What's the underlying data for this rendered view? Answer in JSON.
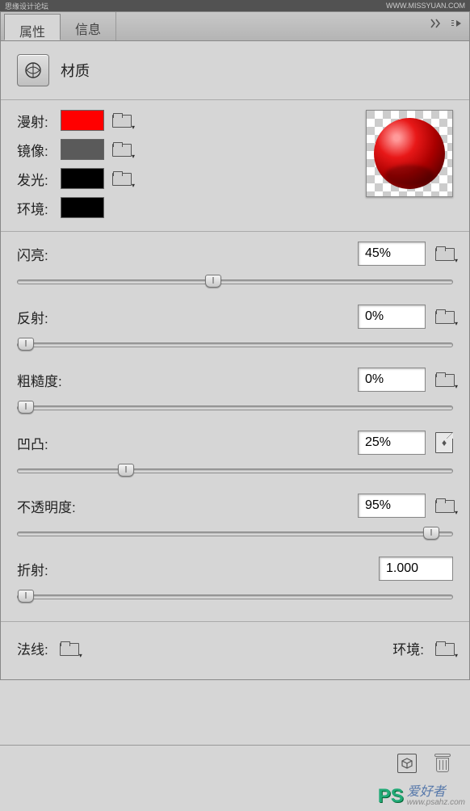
{
  "topbar": {
    "left": "思缘设计论坛",
    "right": "WWW.MISSYUAN.COM"
  },
  "tabs": {
    "properties": "属性",
    "info": "信息"
  },
  "header": {
    "title": "材质"
  },
  "swatches": {
    "diffuse": {
      "label": "漫射:",
      "color": "#ff0000"
    },
    "specular": {
      "label": "镜像:",
      "color": "#5a5a5a"
    },
    "glow": {
      "label": "发光:",
      "color": "#000000"
    },
    "ambient": {
      "label": "环境:",
      "color": "#000000"
    }
  },
  "sliders": {
    "shine": {
      "label": "闪亮:",
      "value": "45%",
      "pos": 45
    },
    "reflection": {
      "label": "反射:",
      "value": "0%",
      "pos": 0
    },
    "roughness": {
      "label": "粗糙度:",
      "value": "0%",
      "pos": 0
    },
    "bump": {
      "label": "凹凸:",
      "value": "25%",
      "pos": 25
    },
    "opacity": {
      "label": "不透明度:",
      "value": "95%",
      "pos": 95
    },
    "refraction": {
      "label": "折射:",
      "value": "1.000",
      "pos": 0
    }
  },
  "footer": {
    "normal": "法线:",
    "environment": "环境:"
  },
  "watermark": {
    "brand": "PS",
    "text": "爱好者",
    "url": "www.psahz.com"
  }
}
